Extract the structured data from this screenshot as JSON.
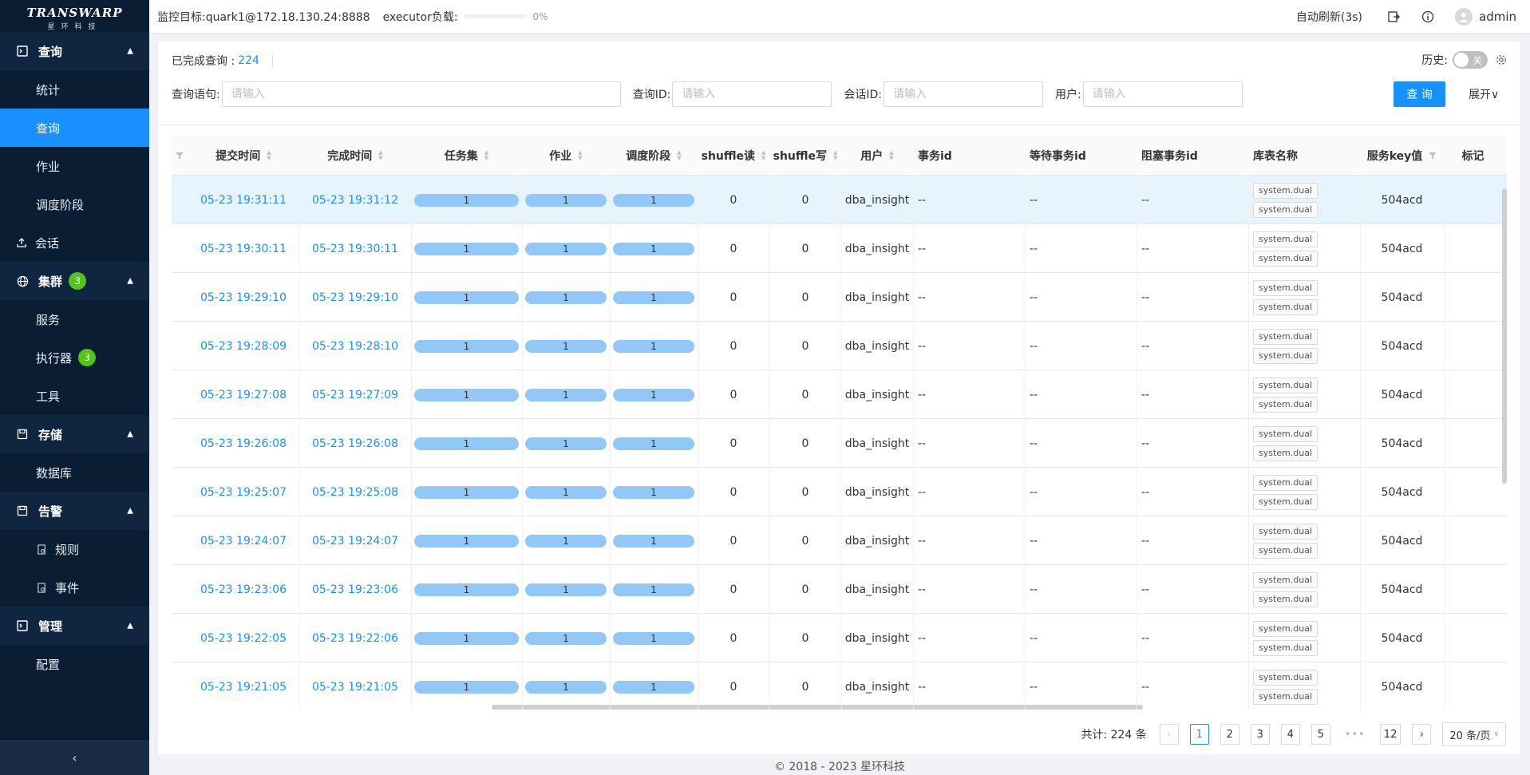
{
  "logo": {
    "main": "TRANSWARP",
    "sub": "星环科技"
  },
  "sidebar": {
    "groups": [
      {
        "label": "查询",
        "items": [
          "统计",
          "查询",
          "作业",
          "调度阶段"
        ]
      },
      {
        "label": "会话"
      },
      {
        "label": "集群",
        "badge": "3",
        "items": [
          "服务",
          "执行器",
          "工具"
        ],
        "executor_badge": "3"
      },
      {
        "label": "存储",
        "items": [
          "数据库"
        ]
      },
      {
        "label": "告警",
        "items": [
          "规则",
          "事件"
        ]
      },
      {
        "label": "管理",
        "items": [
          "配置"
        ]
      }
    ],
    "collapse_icon": "‹"
  },
  "header": {
    "target": "监控目标:quark1@172.18.130.24:8888",
    "executor_label": "executor负载:",
    "executor_pct": "0%",
    "executor_load": 0,
    "refresh": "自动刷新(3s)",
    "user": "admin"
  },
  "toolbar": {
    "done_label": "已完成查询 :",
    "done_count": "224",
    "history_label": "历史:",
    "history_toggle": "关",
    "filters": [
      {
        "label": "查询语句:",
        "placeholder": "请输入"
      },
      {
        "label": "查询ID:",
        "placeholder": "请输入"
      },
      {
        "label": "会话ID:",
        "placeholder": "请输入"
      },
      {
        "label": "用户:",
        "placeholder": "请输入"
      }
    ],
    "query_button": "查 询",
    "expand": "展开∨"
  },
  "table": {
    "columns": [
      "提交时间",
      "完成时间",
      "任务集",
      "作业",
      "调度阶段",
      "shuffle读",
      "shuffle写",
      "用户",
      "事务id",
      "等待事务id",
      "阻塞事务id",
      "库表名称",
      "服务key值",
      "标记"
    ],
    "rows": [
      {
        "submit": "05-23 19:31:11",
        "finish": "05-23 19:31:12",
        "tasks": "1",
        "jobs": "1",
        "stages": "1",
        "sread": "0",
        "swrite": "0",
        "user": "dba_insight",
        "txid": "--",
        "wait": "--",
        "block": "--",
        "tables": [
          "system.dual",
          "system.dual"
        ],
        "key": "504acd"
      },
      {
        "submit": "05-23 19:30:11",
        "finish": "05-23 19:30:11",
        "tasks": "1",
        "jobs": "1",
        "stages": "1",
        "sread": "0",
        "swrite": "0",
        "user": "dba_insight",
        "txid": "--",
        "wait": "--",
        "block": "--",
        "tables": [
          "system.dual",
          "system.dual"
        ],
        "key": "504acd"
      },
      {
        "submit": "05-23 19:29:10",
        "finish": "05-23 19:29:10",
        "tasks": "1",
        "jobs": "1",
        "stages": "1",
        "sread": "0",
        "swrite": "0",
        "user": "dba_insight",
        "txid": "--",
        "wait": "--",
        "block": "--",
        "tables": [
          "system.dual",
          "system.dual"
        ],
        "key": "504acd"
      },
      {
        "submit": "05-23 19:28:09",
        "finish": "05-23 19:28:10",
        "tasks": "1",
        "jobs": "1",
        "stages": "1",
        "sread": "0",
        "swrite": "0",
        "user": "dba_insight",
        "txid": "--",
        "wait": "--",
        "block": "--",
        "tables": [
          "system.dual",
          "system.dual"
        ],
        "key": "504acd"
      },
      {
        "submit": "05-23 19:27:08",
        "finish": "05-23 19:27:09",
        "tasks": "1",
        "jobs": "1",
        "stages": "1",
        "sread": "0",
        "swrite": "0",
        "user": "dba_insight",
        "txid": "--",
        "wait": "--",
        "block": "--",
        "tables": [
          "system.dual",
          "system.dual"
        ],
        "key": "504acd"
      },
      {
        "submit": "05-23 19:26:08",
        "finish": "05-23 19:26:08",
        "tasks": "1",
        "jobs": "1",
        "stages": "1",
        "sread": "0",
        "swrite": "0",
        "user": "dba_insight",
        "txid": "--",
        "wait": "--",
        "block": "--",
        "tables": [
          "system.dual",
          "system.dual"
        ],
        "key": "504acd"
      },
      {
        "submit": "05-23 19:25:07",
        "finish": "05-23 19:25:08",
        "tasks": "1",
        "jobs": "1",
        "stages": "1",
        "sread": "0",
        "swrite": "0",
        "user": "dba_insight",
        "txid": "--",
        "wait": "--",
        "block": "--",
        "tables": [
          "system.dual",
          "system.dual"
        ],
        "key": "504acd"
      },
      {
        "submit": "05-23 19:24:07",
        "finish": "05-23 19:24:07",
        "tasks": "1",
        "jobs": "1",
        "stages": "1",
        "sread": "0",
        "swrite": "0",
        "user": "dba_insight",
        "txid": "--",
        "wait": "--",
        "block": "--",
        "tables": [
          "system.dual",
          "system.dual"
        ],
        "key": "504acd"
      },
      {
        "submit": "05-23 19:23:06",
        "finish": "05-23 19:23:06",
        "tasks": "1",
        "jobs": "1",
        "stages": "1",
        "sread": "0",
        "swrite": "0",
        "user": "dba_insight",
        "txid": "--",
        "wait": "--",
        "block": "--",
        "tables": [
          "system.dual",
          "system.dual"
        ],
        "key": "504acd"
      },
      {
        "submit": "05-23 19:22:05",
        "finish": "05-23 19:22:06",
        "tasks": "1",
        "jobs": "1",
        "stages": "1",
        "sread": "0",
        "swrite": "0",
        "user": "dba_insight",
        "txid": "--",
        "wait": "--",
        "block": "--",
        "tables": [
          "system.dual",
          "system.dual"
        ],
        "key": "504acd"
      },
      {
        "submit": "05-23 19:21:05",
        "finish": "05-23 19:21:05",
        "tasks": "1",
        "jobs": "1",
        "stages": "1",
        "sread": "0",
        "swrite": "0",
        "user": "dba_insight",
        "txid": "--",
        "wait": "--",
        "block": "--",
        "tables": [
          "system.dual",
          "system.dual"
        ],
        "key": "504acd"
      }
    ]
  },
  "pagination": {
    "total": "共计:  224 条",
    "pages": [
      "1",
      "2",
      "3",
      "4",
      "5"
    ],
    "ellipsis": "•••",
    "last": "12",
    "prev": "‹",
    "next": "›",
    "page_size": "20 条/页"
  },
  "footer": "© 2018 - 2023 星环科技",
  "colors": {
    "primary": "#1890ff",
    "sidebar": "#0b1d33",
    "badge": "#52c41a",
    "bar": "#91c8f7"
  }
}
